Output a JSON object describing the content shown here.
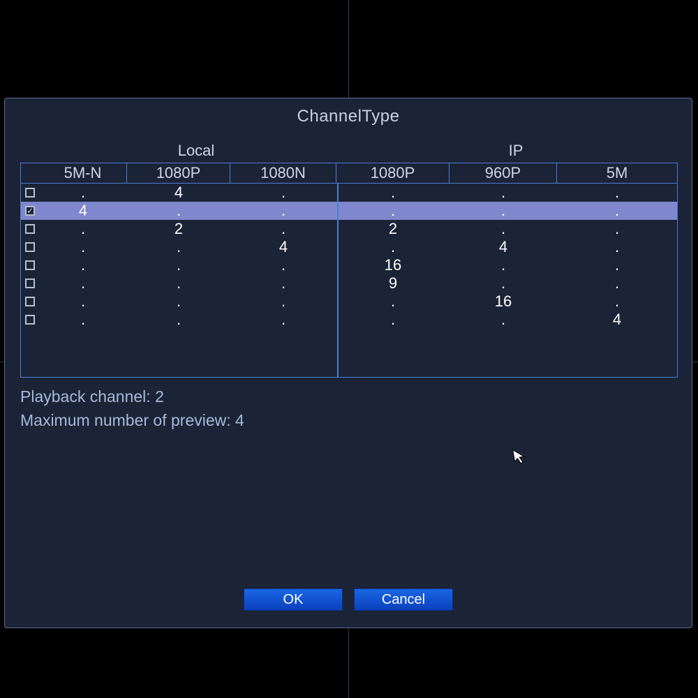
{
  "dialog": {
    "title": "ChannelType",
    "group_headers": {
      "local": "Local",
      "ip": "IP"
    },
    "columns": [
      "5M-N",
      "1080P",
      "1080N",
      "1080P",
      "960P",
      "5M"
    ],
    "rows": [
      {
        "checked": false,
        "cells": [
          ".",
          "4",
          ".",
          ".",
          ".",
          "."
        ]
      },
      {
        "checked": true,
        "cells": [
          "4",
          ".",
          ".",
          ".",
          ".",
          "."
        ]
      },
      {
        "checked": false,
        "cells": [
          ".",
          "2",
          ".",
          "2",
          ".",
          "."
        ]
      },
      {
        "checked": false,
        "cells": [
          ".",
          ".",
          "4",
          ".",
          "4",
          "."
        ]
      },
      {
        "checked": false,
        "cells": [
          ".",
          ".",
          ".",
          "16",
          ".",
          "."
        ]
      },
      {
        "checked": false,
        "cells": [
          ".",
          ".",
          ".",
          "9",
          ".",
          "."
        ]
      },
      {
        "checked": false,
        "cells": [
          ".",
          ".",
          ".",
          ".",
          "16",
          "."
        ]
      },
      {
        "checked": false,
        "cells": [
          ".",
          ".",
          ".",
          ".",
          ".",
          "4"
        ]
      }
    ],
    "selected_index": 1,
    "info": {
      "playback_label": "Playback channel: ",
      "playback_value": "2",
      "preview_label": "Maximum number of preview: ",
      "preview_value": "4"
    },
    "buttons": {
      "ok": "OK",
      "cancel": "Cancel"
    }
  }
}
